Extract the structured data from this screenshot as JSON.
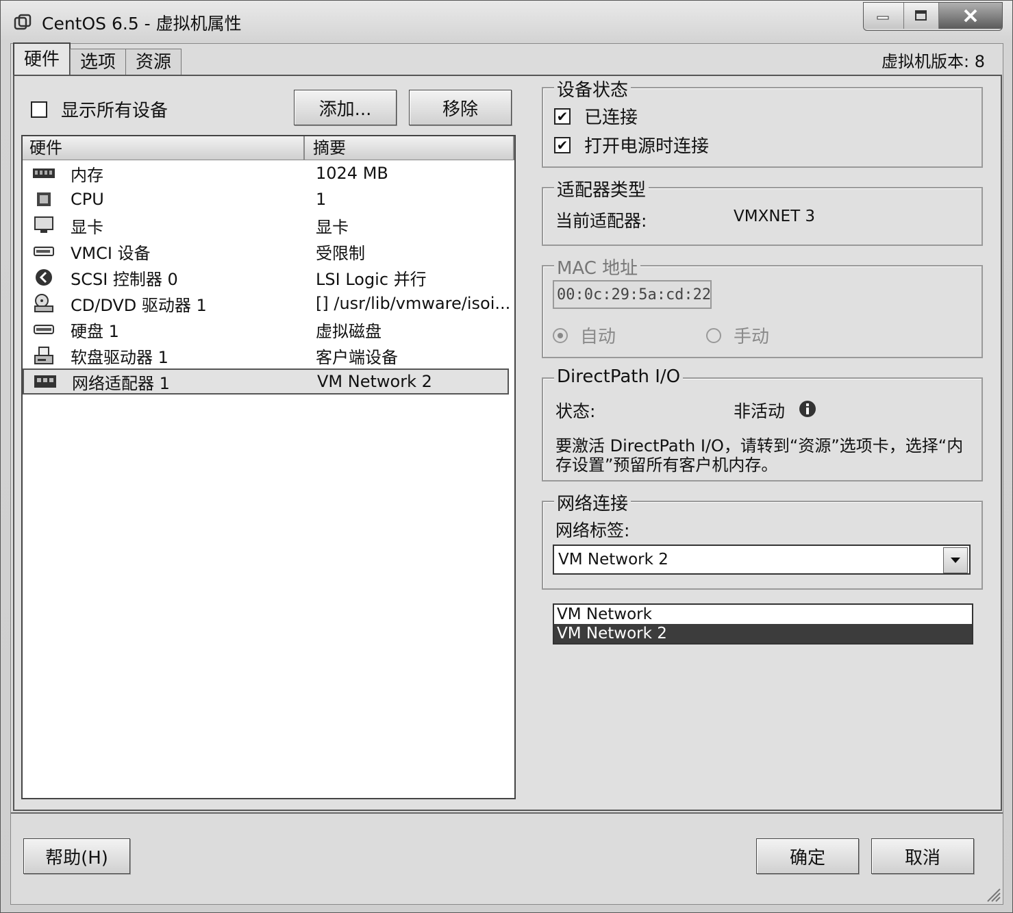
{
  "window": {
    "title": "CentOS 6.5 - 虚拟机属性",
    "controls": [
      "minimize",
      "maximize",
      "close"
    ]
  },
  "tabs": [
    {
      "label": "硬件",
      "active": true
    },
    {
      "label": "选项",
      "active": false
    },
    {
      "label": "资源",
      "active": false
    }
  ],
  "vm_version": "虚拟机版本: 8",
  "hardware_panel": {
    "show_all_label": "显示所有设备",
    "show_all_checked": false,
    "add_button": "添加...",
    "remove_button": "移除",
    "columns": [
      "硬件",
      "摘要"
    ],
    "rows": [
      {
        "icon": "memory-icon",
        "name": "内存",
        "summary": "1024 MB"
      },
      {
        "icon": "cpu-icon",
        "name": "CPU",
        "summary": "1"
      },
      {
        "icon": "display-icon",
        "name": "显卡",
        "summary": "显卡"
      },
      {
        "icon": "vmci-icon",
        "name": "VMCI 设备",
        "summary": "受限制"
      },
      {
        "icon": "scsi-icon",
        "name": "SCSI 控制器 0",
        "summary": "LSI Logic 并行"
      },
      {
        "icon": "cd-dvd-icon",
        "name": "CD/DVD 驱动器 1",
        "summary": "[] /usr/lib/vmware/isoi..."
      },
      {
        "icon": "harddisk-icon",
        "name": "硬盘 1",
        "summary": "虚拟磁盘"
      },
      {
        "icon": "floppy-icon",
        "name": "软盘驱动器 1",
        "summary": "客户端设备"
      },
      {
        "icon": "network-adapter-icon",
        "name": "网络适配器 1",
        "summary": "VM Network 2",
        "selected": true
      }
    ]
  },
  "device_status": {
    "title": "设备状态",
    "connected_label": "已连接",
    "connected_checked": true,
    "connect_at_power_on_label": "打开电源时连接",
    "connect_at_power_on_checked": true
  },
  "adapter_type": {
    "title": "适配器类型",
    "current_label": "当前适配器:",
    "current_value": "VMXNET 3"
  },
  "mac_address": {
    "title": "MAC 地址",
    "value": "00:0c:29:5a:cd:22",
    "auto_label": "自动",
    "manual_label": "手动",
    "selected": "auto"
  },
  "directpath": {
    "title": "DirectPath I/O",
    "status_label": "状态:",
    "status_value": "非活动",
    "info_line1": "要激活 DirectPath I/O，请转到“资源”选项卡，选择“内",
    "info_line2": "存设置”预留所有客户机内存。"
  },
  "network_connection": {
    "title": "网络连接",
    "label": "网络标签:",
    "selected": "VM Network 2",
    "options": [
      "VM Network",
      "VM Network 2"
    ]
  },
  "footer": {
    "help_button": "帮助(H)",
    "ok_button": "确定",
    "cancel_button": "取消"
  }
}
